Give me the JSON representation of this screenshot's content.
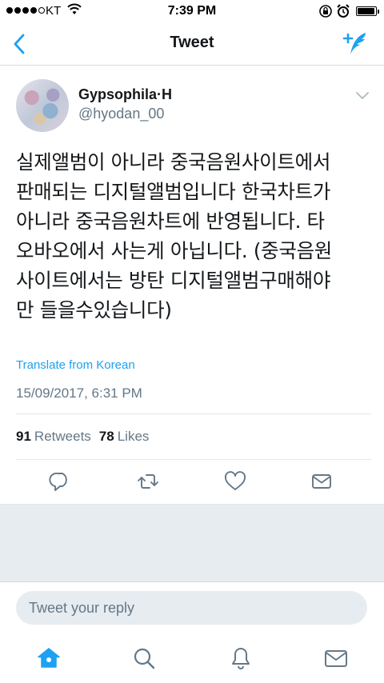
{
  "status_bar": {
    "carrier": "KT",
    "time": "7:39 PM",
    "signal_bars_filled": 4,
    "signal_bars_total": 5,
    "battery_level": 0.95
  },
  "nav": {
    "title": "Tweet",
    "back_icon": "chevron-left-icon",
    "compose_icon": "compose-tweet-icon",
    "accent_color": "#1da1f2"
  },
  "tweet": {
    "display_name": "Gypsophila·H",
    "username": "@hyodan_00",
    "text": "실제앨범이 아니라 중국음원사이트에서\n판매되는 디지털앨범입니다 한국차트가\n아니라 중국음원차트에 반영됩니다. 타\n오바오에서 사는게 아닙니다. (중국음원\n사이트에서는 방탄 디지털앨범구매해야\n만 들을수있습니다)",
    "translate_label": "Translate from Korean",
    "timestamp": "15/09/2017, 6:31 PM",
    "retweets_count": "91",
    "retweets_label": "Retweets",
    "likes_count": "78",
    "likes_label": "Likes"
  },
  "actions": [
    "reply-icon",
    "retweet-icon",
    "like-icon",
    "direct-message-icon"
  ],
  "reply": {
    "placeholder": "Tweet your reply"
  },
  "tab_bar": {
    "tabs": [
      "home-icon",
      "search-icon",
      "notifications-icon",
      "messages-icon"
    ],
    "active_tab": "home-icon"
  }
}
